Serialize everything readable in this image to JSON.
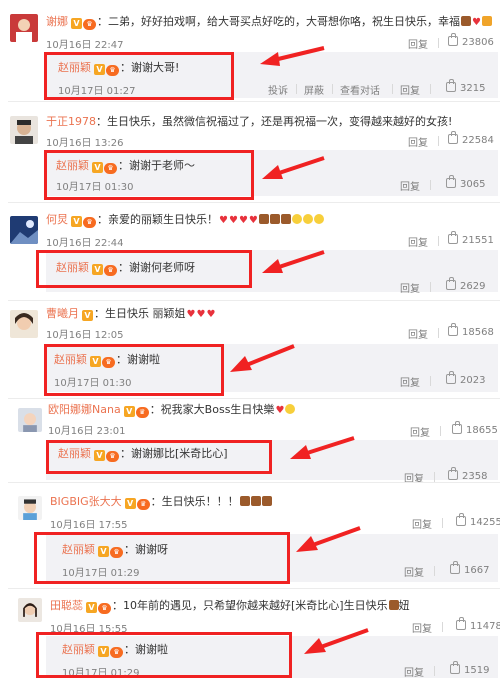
{
  "comments": [
    {
      "username": "谢娜",
      "text": "：二弟，好好拍戏啊，给大哥买点好吃的，大哥想你咯，祝生日快乐，幸福",
      "time": "10月16日 22:47",
      "reply_label": "回复",
      "likes": "23806",
      "reply": {
        "username": "赵丽颖",
        "text": "：谢谢大哥!",
        "time": "10月17日 01:27",
        "actions": [
          "投诉",
          "屏蔽",
          "查看对话",
          "回复"
        ],
        "likes": "3215"
      }
    },
    {
      "username": "于正1978",
      "text": "：生日快乐，虽然微信祝福过了，还是再祝福一次，变得越来越好的女孩!",
      "time": "10月16日 13:26",
      "reply_label": "回复",
      "likes": "22584",
      "reply": {
        "username": "赵丽颖",
        "text": "：谢谢于老师～",
        "time": "10月17日 01:30",
        "actions": [
          "回复"
        ],
        "likes": "3065"
      }
    },
    {
      "username": "何炅",
      "text": "：亲爱的丽颖生日快乐！",
      "time": "10月16日 22:44",
      "reply_label": "回复",
      "likes": "21551",
      "reply": {
        "username": "赵丽颖",
        "text": "：谢谢何老师呀",
        "time": "",
        "actions": [
          "回复"
        ],
        "likes": "2629"
      }
    },
    {
      "username": "曹曦月",
      "text": "：生日快乐 丽颖姐",
      "time": "10月16日 12:05",
      "reply_label": "回复",
      "likes": "18568",
      "reply": {
        "username": "赵丽颖",
        "text": "：谢谢啦",
        "time": "10月17日 01:30",
        "actions": [
          "回复"
        ],
        "likes": "2023"
      }
    },
    {
      "username": "欧阳娜娜Nana",
      "text": "：祝我家大Boss生日快樂",
      "time": "10月16日 23:01",
      "reply_label": "回复",
      "likes": "18655",
      "reply": {
        "username": "赵丽颖",
        "text": "：谢谢娜比[米奇比心]",
        "time": "",
        "actions": [
          "回复"
        ],
        "likes": "2358"
      }
    },
    {
      "username": "BIGBIG张大大",
      "text": "：生日快乐！！！",
      "time": "10月16日 17:55",
      "reply_label": "回复",
      "likes": "14255",
      "reply": {
        "username": "赵丽颖",
        "text": "：谢谢呀",
        "time": "10月17日 01:29",
        "actions": [
          "回复"
        ],
        "likes": "1667"
      }
    },
    {
      "username": "田聪蕊",
      "text": "：10年前的遇见，只希望你越来越好[米奇比心]生日快乐",
      "text_tail": "妞",
      "time": "10月16日 15:55",
      "reply_label": "回复",
      "likes": "11478",
      "reply": {
        "username": "赵丽颖",
        "text": "：谢谢啦",
        "time": "10月17日 01:29",
        "actions": [
          "回复"
        ],
        "likes": "1519"
      }
    }
  ],
  "colors": {
    "username": "#eb7350",
    "annotation_red": "#f02222",
    "reply_bg": "#f2f2f5",
    "meta_gray": "#808080"
  },
  "icons": [
    "vip-v-icon",
    "level-badge-icon",
    "thumb-up-icon",
    "cake-emoji",
    "heart-emoji",
    "smile-emoji",
    "arrow-annotation"
  ]
}
